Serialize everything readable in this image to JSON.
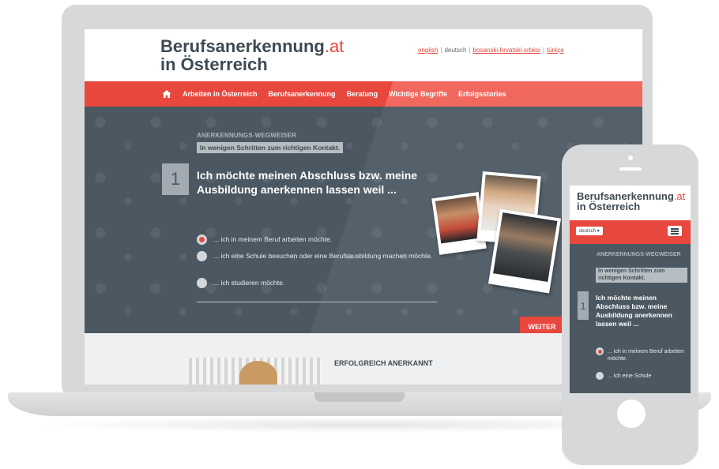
{
  "site": {
    "logo_main": "Berufsanerkennung",
    "logo_tld": ".at",
    "logo_line2": "in Österreich"
  },
  "languages": [
    {
      "label": "english",
      "link": true
    },
    {
      "label": "deutsch",
      "link": false
    },
    {
      "label": "bosanski-hrvatski-srbksi",
      "link": true
    },
    {
      "label": "türkçe",
      "link": true
    }
  ],
  "nav": {
    "items": [
      "Arbeiten in Österreich",
      "Berufsanerkennung",
      "Beratung",
      "Wichtige Begriffe",
      "Erfolgsstories"
    ]
  },
  "wizard": {
    "title": "ANERKENNUNGS-WEGWEISER",
    "subtitle": "In wenigen Schritten zum richtigen Kontakt.",
    "step": "1",
    "question": "Ich möchte meinen Abschluss bzw. meine Ausbildung anerkennen lassen weil ...",
    "options": [
      {
        "label": "... ich in meinem Beruf arbeiten möchte.",
        "selected": true
      },
      {
        "label": "... ich eine Schule besuchen oder eine Berufsausbildung machen möchte.",
        "selected": false
      },
      {
        "label": "... ich studieren möchte.",
        "selected": false
      }
    ],
    "next_label": "WEITER"
  },
  "section2": {
    "title": "ERFOLGREICH ANERKANNT"
  },
  "mobile": {
    "logo_main": "Berufsanerkennung",
    "logo_tld": ".at",
    "logo_line2": "in Österreich",
    "lang_select": "deutsch ▾",
    "title": "ANERKENNUNGS-WEGWEISER",
    "subtitle": "In wenigen Schritten zum richtigen Kontakt.",
    "step": "1",
    "question": "Ich möchte meinen Abschluss bzw. meine Ausbildung anerkennen lassen weil ...",
    "option1": "... ich in meinem Beruf arbeiten möchte.",
    "option2": "... ich eine Schule"
  },
  "colors": {
    "accent": "#e8473d",
    "hero_bg": "#4b5862",
    "text_dark": "#3e4a52",
    "device": "#d7d8d9"
  }
}
